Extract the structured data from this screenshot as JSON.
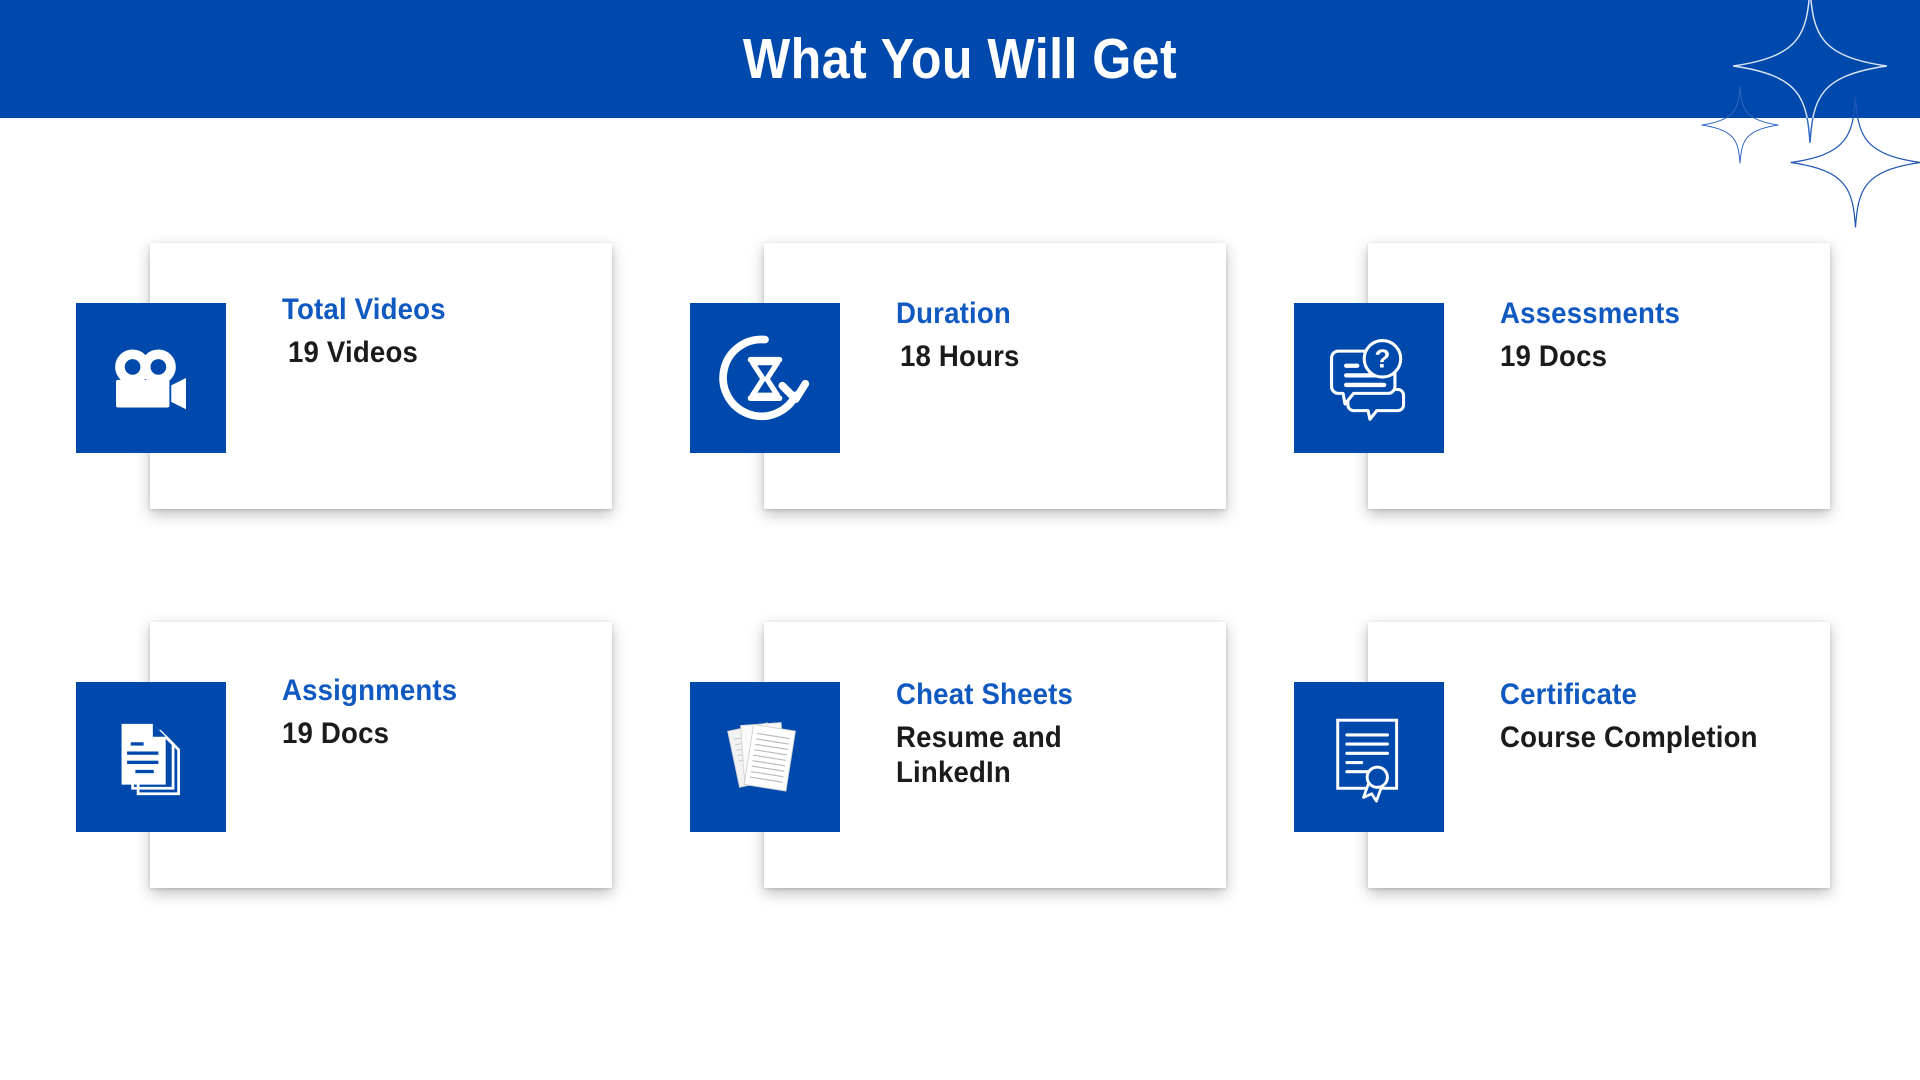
{
  "header": {
    "title": "What You Will Get",
    "background_color": "#0049ac",
    "text_color": "#ffffff"
  },
  "theme": {
    "brand_blue": "#0049ac",
    "title_blue": "#1059c0",
    "value_black": "#1b1b1b",
    "page_background": "#ffffff"
  },
  "decorations": [
    {
      "name": "sparkle-large",
      "shape": "four-point-star"
    },
    {
      "name": "sparkle-small",
      "shape": "four-point-star"
    },
    {
      "name": "sparkle-medium",
      "shape": "four-point-star"
    }
  ],
  "cards": [
    {
      "id": "total-videos",
      "icon": "video-camera-icon",
      "title": "Total Videos",
      "value": "19 Videos"
    },
    {
      "id": "duration",
      "icon": "hourglass-refresh-icon",
      "title": "Duration",
      "value": "18 Hours"
    },
    {
      "id": "assessments",
      "icon": "chat-question-icon",
      "title": "Assessments",
      "value": "19 Docs"
    },
    {
      "id": "assignments",
      "icon": "document-stack-icon",
      "title": "Assignments",
      "value": "19 Docs"
    },
    {
      "id": "cheat-sheets",
      "icon": "papers-scatter-icon",
      "title": "Cheat Sheets",
      "value": "Resume and\nLinkedIn"
    },
    {
      "id": "certificate",
      "icon": "certificate-ribbon-icon",
      "title": "Certificate",
      "value": "Course Completion"
    }
  ]
}
